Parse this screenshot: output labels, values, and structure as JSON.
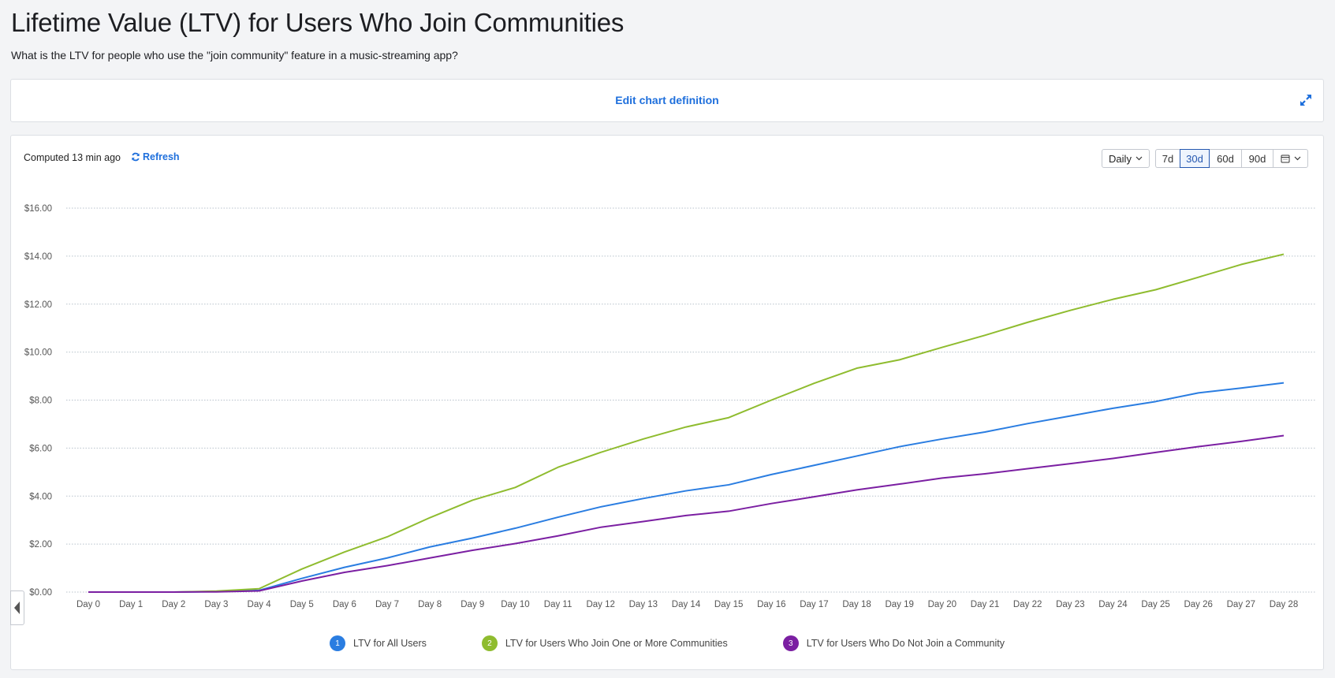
{
  "page": {
    "title": "Lifetime Value (LTV) for Users Who Join Communities",
    "subtitle": "What is the LTV for people who use the \"join community\" feature in a music-streaming app?"
  },
  "edit_card": {
    "edit_label": "Edit chart definition",
    "expand_icon": "expand-arrows-icon"
  },
  "toolbar": {
    "computed": "Computed 13 min ago",
    "refresh_label": "Refresh",
    "interval": "Daily",
    "ranges": [
      "7d",
      "30d",
      "60d",
      "90d"
    ],
    "active_range": "30d",
    "calendar_icon": "calendar-icon"
  },
  "colors": {
    "accent": "#1e6fdc",
    "series1": "#2a7de1",
    "series2": "#8fbc2f",
    "series3": "#7b1fa2"
  },
  "chart_data": {
    "type": "line",
    "x": [
      "Day 0",
      "Day 1",
      "Day 2",
      "Day 3",
      "Day 4",
      "Day 5",
      "Day 6",
      "Day 7",
      "Day 8",
      "Day 9",
      "Day 10",
      "Day 11",
      "Day 12",
      "Day 13",
      "Day 14",
      "Day 15",
      "Day 16",
      "Day 17",
      "Day 18",
      "Day 19",
      "Day 20",
      "Day 21",
      "Day 22",
      "Day 23",
      "Day 24",
      "Day 25",
      "Day 26",
      "Day 27",
      "Day 28"
    ],
    "yticks": [
      "$0.00",
      "$2.00",
      "$4.00",
      "$6.00",
      "$8.00",
      "$10.00",
      "$12.00",
      "$14.00",
      "$16.00"
    ],
    "ylim": [
      0,
      16
    ],
    "grid": true,
    "legend_position": "bottom",
    "series": [
      {
        "name": "LTV for All Users",
        "badge": "1",
        "color": "#2a7de1",
        "values": [
          0,
          0,
          0,
          0.02,
          0.07,
          0.57,
          1.03,
          1.42,
          1.88,
          2.25,
          2.66,
          3.12,
          3.55,
          3.9,
          4.22,
          4.47,
          4.9,
          5.28,
          5.67,
          6.06,
          6.38,
          6.67,
          7.02,
          7.34,
          7.66,
          7.94,
          8.3,
          8.5,
          8.72
        ]
      },
      {
        "name": "LTV for Users Who Join One or More Communities",
        "badge": "2",
        "color": "#8fbc2f",
        "values": [
          0,
          0,
          0,
          0.04,
          0.14,
          0.96,
          1.67,
          2.3,
          3.1,
          3.83,
          4.36,
          5.2,
          5.82,
          6.38,
          6.88,
          7.27,
          8.0,
          8.7,
          9.33,
          9.68,
          10.2,
          10.7,
          11.24,
          11.74,
          12.2,
          12.6,
          13.12,
          13.65,
          14.08
        ]
      },
      {
        "name": "LTV for Users Who Do Not Join a Community",
        "badge": "3",
        "color": "#7b1fa2",
        "values": [
          0,
          0,
          0,
          0.01,
          0.05,
          0.46,
          0.82,
          1.1,
          1.42,
          1.74,
          2.02,
          2.34,
          2.7,
          2.94,
          3.19,
          3.37,
          3.69,
          3.97,
          4.26,
          4.5,
          4.75,
          4.93,
          5.14,
          5.35,
          5.57,
          5.82,
          6.06,
          6.28,
          6.52
        ]
      }
    ]
  }
}
